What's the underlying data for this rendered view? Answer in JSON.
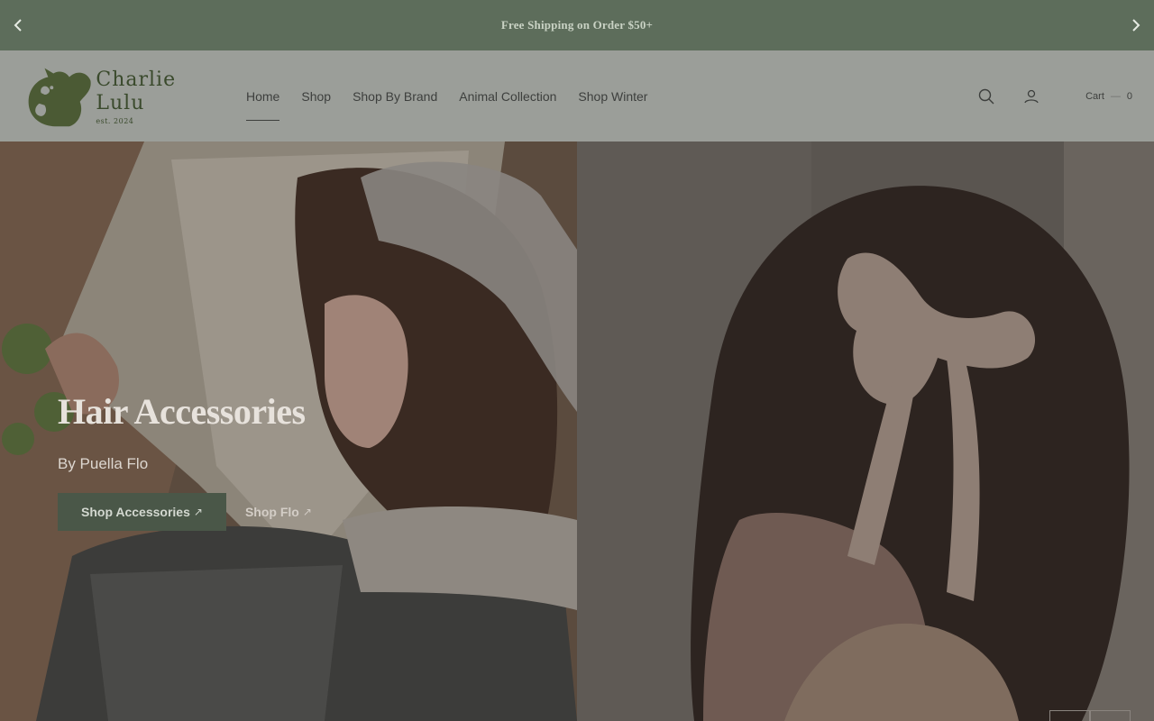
{
  "announcement": {
    "message": "Free Shipping on Order $50+",
    "prev_icon": "chevron-left-icon",
    "next_icon": "chevron-right-icon"
  },
  "header": {
    "logo": {
      "name": "Charlie Lulu",
      "tagline": "est. 2024"
    },
    "nav": [
      {
        "label": "Home",
        "active": true
      },
      {
        "label": "Shop"
      },
      {
        "label": "Shop By Brand"
      },
      {
        "label": "Animal Collection"
      },
      {
        "label": "Shop Winter"
      }
    ],
    "search_icon": "search-icon",
    "account_icon": "user-icon",
    "cart": {
      "label": "Cart",
      "count": "0"
    }
  },
  "hero": {
    "title": "Hair Accessories",
    "subtitle": "By Puella Flo",
    "primary_cta": "Shop Accessories",
    "secondary_cta": "Shop Flo",
    "cta_icon": "↗"
  },
  "colors": {
    "announcement_bg": "#5d6d5b",
    "header_bg": "#9b9e99",
    "brand_green": "#3a4a2c",
    "button_bg": "#4a5748"
  }
}
